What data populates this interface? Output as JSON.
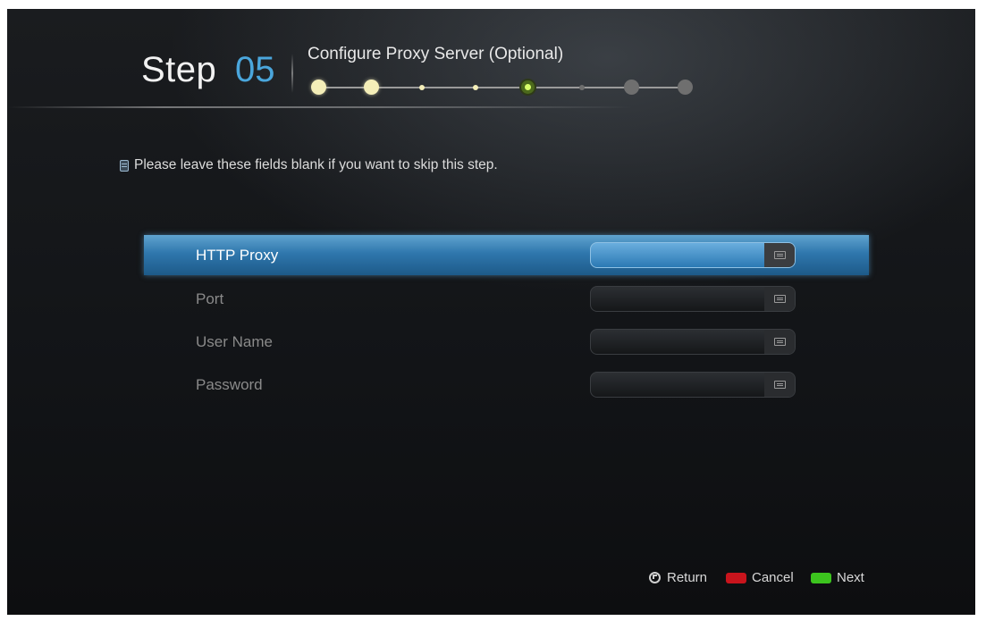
{
  "header": {
    "step_word": "Step",
    "step_number": "05",
    "title": "Configure Proxy Server (Optional)"
  },
  "progress": {
    "total_steps": 8,
    "current_step": 5
  },
  "info": {
    "text": "Please leave these fields blank if you want to skip this step."
  },
  "form": {
    "fields": [
      {
        "label": "HTTP Proxy",
        "value": "",
        "selected": true
      },
      {
        "label": "Port",
        "value": "",
        "selected": false
      },
      {
        "label": "User Name",
        "value": "",
        "selected": false
      },
      {
        "label": "Password",
        "value": "",
        "selected": false
      }
    ]
  },
  "footer": {
    "return_label": "Return",
    "cancel_label": "Cancel",
    "next_label": "Next",
    "cancel_color": "#c8141c",
    "next_color": "#3cc41e"
  },
  "colors": {
    "accent": "#4aa6dc",
    "selected_row": "#2f77ad"
  }
}
